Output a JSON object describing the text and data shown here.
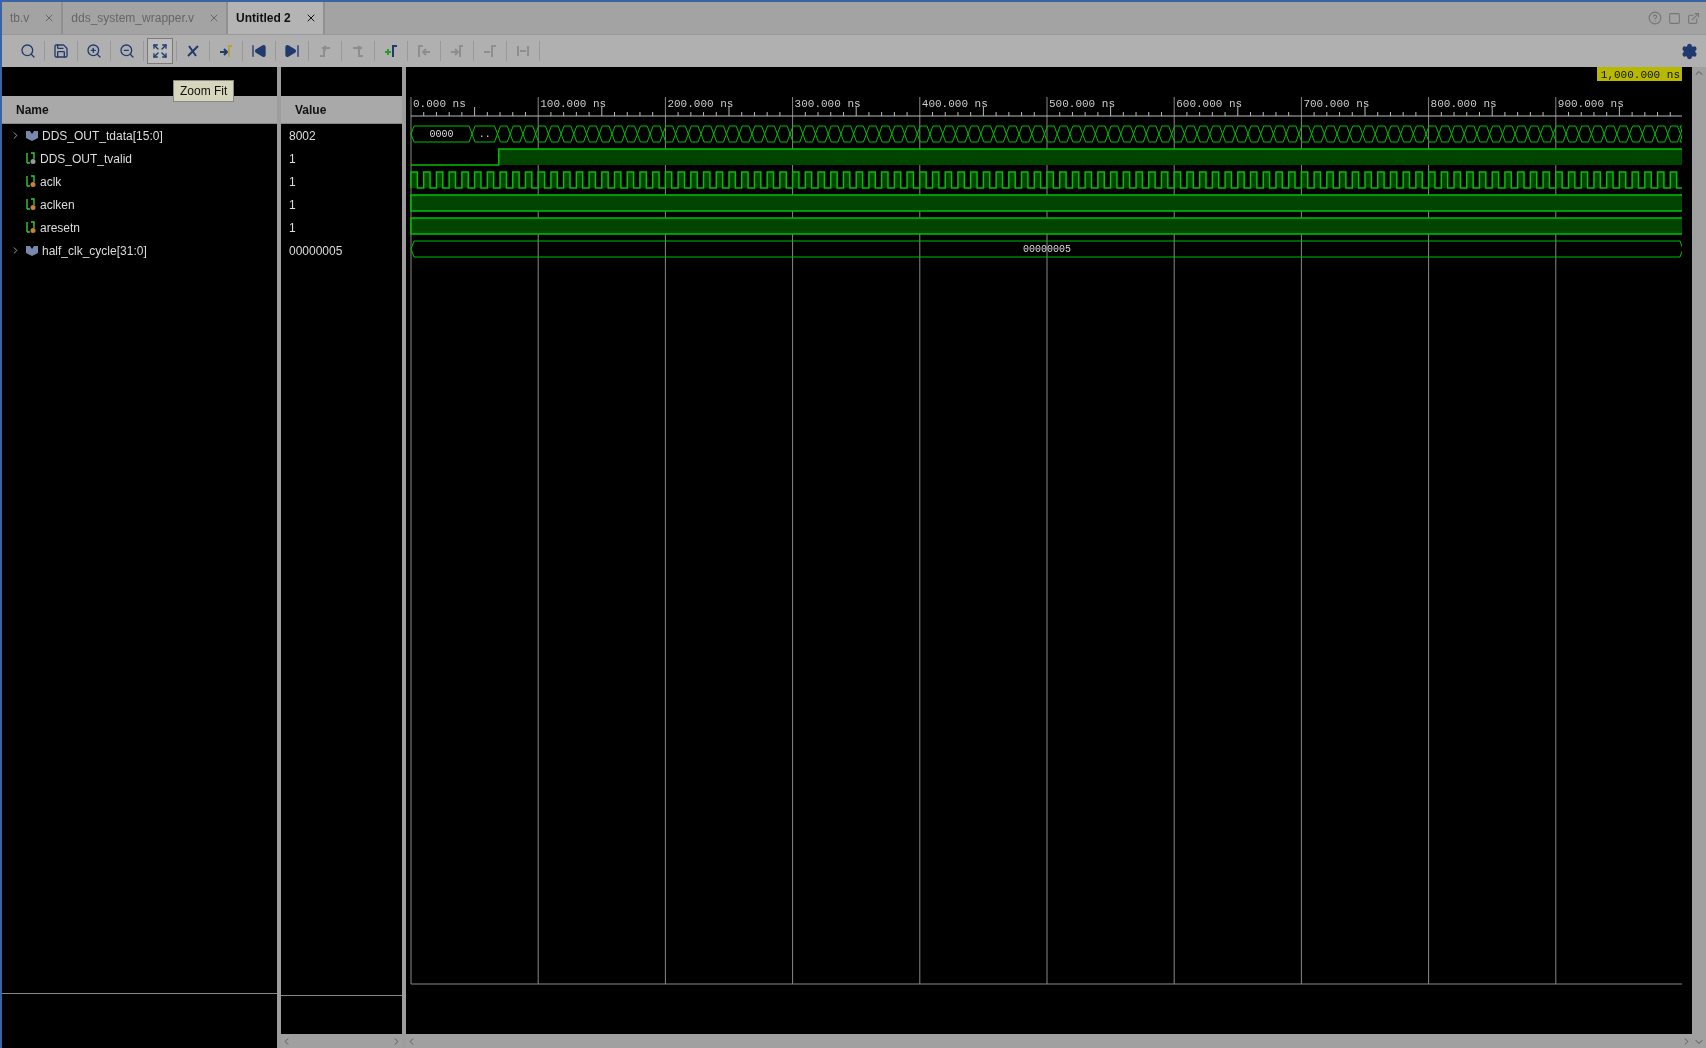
{
  "tabs": [
    {
      "label": "tb.v",
      "selected": false
    },
    {
      "label": "dds_system_wrapper.v",
      "selected": false
    },
    {
      "label": "Untitled 2",
      "selected": true
    }
  ],
  "toolbar": [
    {
      "kind": "search",
      "disabled": false,
      "selected": false
    },
    {
      "kind": "save",
      "disabled": false,
      "selected": false
    },
    {
      "kind": "zoom_in",
      "disabled": false,
      "selected": false
    },
    {
      "kind": "zoom_out",
      "disabled": false,
      "selected": false
    },
    {
      "kind": "zoom_fit",
      "disabled": false,
      "selected": true
    },
    {
      "kind": "cursor_off",
      "disabled": false,
      "selected": false
    },
    {
      "kind": "goto_cursor",
      "disabled": false,
      "selected": false
    },
    {
      "kind": "go_start",
      "disabled": false,
      "selected": false
    },
    {
      "kind": "go_end",
      "disabled": false,
      "selected": false
    },
    {
      "kind": "prev_transition",
      "disabled": true,
      "selected": false
    },
    {
      "kind": "next_transition",
      "disabled": true,
      "selected": false
    },
    {
      "kind": "add_marker",
      "disabled": false,
      "selected": false
    },
    {
      "kind": "prev_marker",
      "disabled": true,
      "selected": false
    },
    {
      "kind": "next_marker",
      "disabled": true,
      "selected": false
    },
    {
      "kind": "swap_cursor",
      "disabled": true,
      "selected": false
    },
    {
      "kind": "snap",
      "disabled": true,
      "selected": false
    }
  ],
  "tooltip": "Zoom Fit",
  "columns": {
    "name": "Name",
    "value": "Value"
  },
  "ruler": {
    "labels": [
      "0.000 ns",
      "100.000 ns",
      "200.000 ns",
      "300.000 ns",
      "400.000 ns",
      "500.000 ns",
      "600.000 ns",
      "700.000 ns",
      "800.000 ns",
      "900.000 ns"
    ],
    "cursor": "1,000.000 ns"
  },
  "signals": [
    {
      "name": "DDS_OUT_tdata[15:0]",
      "value": "8002",
      "kind": "bus",
      "expanded": false,
      "waveform": {
        "kind": "counter"
      },
      "segments": [
        "0000",
        ".."
      ]
    },
    {
      "name": "DDS_OUT_tvalid",
      "value": "1",
      "kind": "bit_out",
      "waveform": {
        "kind": "step"
      }
    },
    {
      "name": "aclk",
      "value": "1",
      "kind": "bit_in",
      "waveform": {
        "kind": "clock"
      }
    },
    {
      "name": "aclken",
      "value": "1",
      "kind": "bit_in",
      "waveform": {
        "kind": "high"
      }
    },
    {
      "name": "aresetn",
      "value": "1",
      "kind": "bit_in",
      "waveform": {
        "kind": "high"
      }
    },
    {
      "name": "half_clk_cycle[31:0]",
      "value": "00000005",
      "kind": "bus",
      "expanded": false,
      "waveform": {
        "kind": "constant"
      },
      "segments": [
        "00000005"
      ]
    }
  ]
}
